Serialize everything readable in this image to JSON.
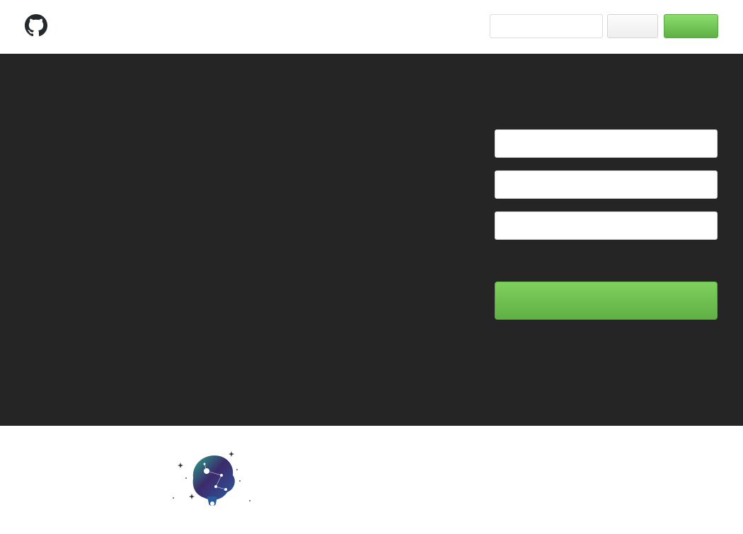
{
  "header": {
    "search_placeholder": "",
    "signin_label": "",
    "signup_label": ""
  },
  "hero": {
    "headline": "",
    "subheading": ""
  },
  "signup_form": {
    "username_placeholder": "",
    "email_placeholder": "",
    "password_placeholder": "",
    "hint": "",
    "submit_label": "",
    "legal": ""
  },
  "icons": {
    "logo": "github-octocat-icon",
    "illustration": "space-planet-illustration"
  },
  "colors": {
    "hero_background": "#252525",
    "primary_green": "#6cc644",
    "illustration_teal": "#2aa889",
    "illustration_purple": "#3b2a6b",
    "illustration_blue": "#2b5a9e"
  }
}
